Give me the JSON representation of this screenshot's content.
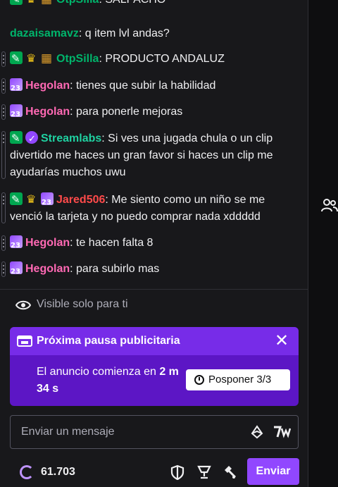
{
  "messages": [
    {
      "user": "OtpSilla",
      "user_color": "#00b46b",
      "text": "SALPACHO"
    },
    {
      "user": "dazaisamavz",
      "user_color": "#00b46b",
      "text": "q item lvl andas?"
    },
    {
      "user": "OtpSilla",
      "user_color": "#00b46b",
      "text": "PRODUCTO ANDALUZ"
    },
    {
      "user": "Hegolan",
      "user_color": "#ff69b4",
      "text": "tienes que subir la habilidad"
    },
    {
      "user": "Hegolan",
      "user_color": "#ff69b4",
      "text": "para ponerle mejoras"
    },
    {
      "user": "Streamlabs",
      "user_color": "#1fd1a1",
      "text": "Si ves una jugada chula o un clip divertido me haces un gran favor si haces un clip me ayudarías muchos uwu"
    },
    {
      "user": "Jared506",
      "user_color": "#ff4a4a",
      "text": "Me siento como un niño se me venció la tarjeta y no puedo comprar nada xddddd"
    },
    {
      "user": "Hegolan",
      "user_color": "#ff69b4",
      "text": "te hacen falta 8"
    },
    {
      "user": "Hegolan",
      "user_color": "#ff69b4",
      "text": "para subirlo mas"
    }
  ],
  "visibility": {
    "label": "Visible solo para ti"
  },
  "ad": {
    "title": "Próxima pausa publicitaria",
    "body_prefix": "El anuncio comienza en ",
    "body_bold_1": "2 m",
    "body_bold_2": "34 s",
    "snooze_label": "Posponer 3/3",
    "accent": "#772ce8"
  },
  "chat_input": {
    "placeholder": "Enviar un mensaje"
  },
  "bottom": {
    "points": "61.703",
    "send_label": "Enviar",
    "send_color": "#9147ff"
  },
  "icons": [
    "eye-icon",
    "ad-icon",
    "close-icon",
    "clock-icon",
    "bits-icon",
    "emote-icon",
    "points-icon",
    "shield-icon",
    "trophy-icon",
    "mod-hammer-icon",
    "users-icon"
  ]
}
